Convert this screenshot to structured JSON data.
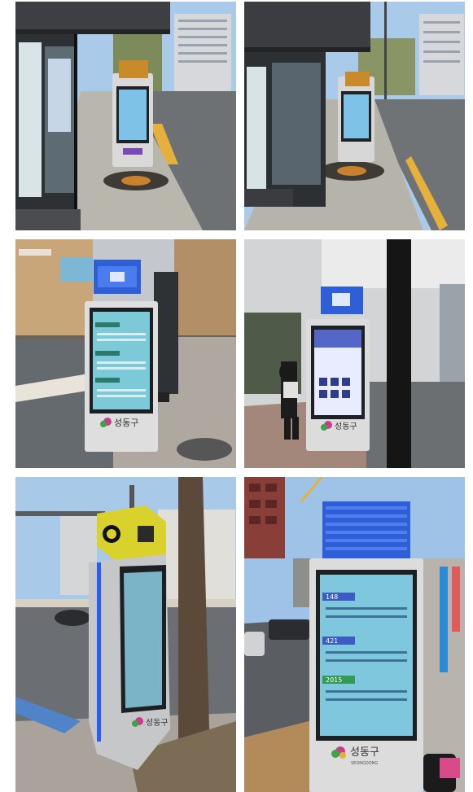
{
  "photos": [
    {
      "id": "p1",
      "subject": "bus-shelter-with-small-info-kiosk"
    },
    {
      "id": "p2",
      "subject": "bus-shelter-with-small-info-kiosk-alt-angle"
    },
    {
      "id": "p3",
      "subject": "tall-kiosk-with-blue-led-cube"
    },
    {
      "id": "p4",
      "subject": "tall-kiosk-with-touch-menu-and-pedestrian"
    },
    {
      "id": "p5",
      "subject": "angular-kiosk-with-yellow-cube"
    },
    {
      "id": "p6",
      "subject": "tall-kiosk-with-route-list"
    }
  ],
  "brand": {
    "logo_text": "성동구",
    "logo_sub": "SEONGDONG"
  },
  "screen_routes": {
    "route_a": "148",
    "route_b": "421",
    "route_c": "2015"
  },
  "colors": {
    "sky": "#9ec3e6",
    "road": "#7b7f83",
    "kiosk_body": "#dcdcdc",
    "screen": "#6fb3d2",
    "led_blue": "#2f5fd6",
    "led_yellow": "#d9d12c"
  }
}
